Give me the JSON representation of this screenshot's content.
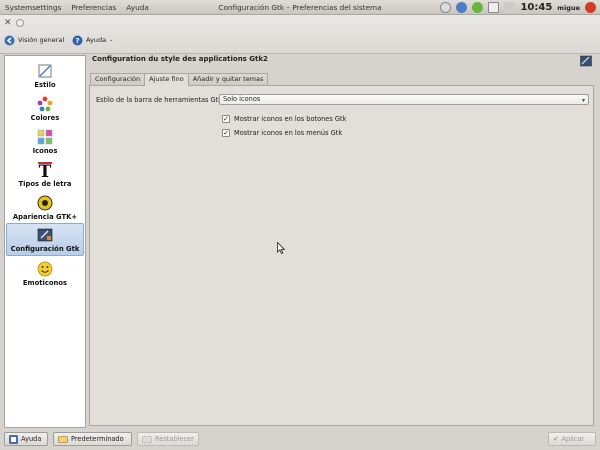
{
  "top_panel": {
    "menus": [
      "Systemsettings",
      "Preferencias",
      "Ayuda"
    ],
    "window_title": "Configuración Gtk – Preferencias del sistema",
    "clock": "10:45",
    "user": "migue"
  },
  "toolbar": {
    "overview_label": "Visión general",
    "help_label": "Ayuda"
  },
  "sidebar": {
    "items": [
      {
        "label": "Estilo",
        "icon": "style-icon"
      },
      {
        "label": "Colores",
        "icon": "colors-icon"
      },
      {
        "label": "Iconos",
        "icon": "icons-icon"
      },
      {
        "label": "Tipos de letra",
        "icon": "fonts-icon"
      },
      {
        "label": "Apariencia GTK+",
        "icon": "gtk-appearance-icon"
      },
      {
        "label": "Configuración Gtk",
        "icon": "gtk-config-icon"
      },
      {
        "label": "Emoticonos",
        "icon": "emoticons-icon"
      }
    ],
    "active_index": 5
  },
  "main": {
    "title": "Configuration du style des applications Gtk2",
    "tabs": [
      "Configuración",
      "Ajuste fino",
      "Añadir y quitar temas"
    ],
    "active_tab": 1,
    "toolbar_style_label": "Estilo de la barra de herramientas Gtk",
    "toolbar_style_value": "Solo iconos",
    "checks": [
      {
        "label": "Mostrar iconos en los botones Gtk",
        "checked": true
      },
      {
        "label": "Mostrar iconos en los menús Gtk",
        "checked": true
      }
    ]
  },
  "bottom": {
    "help_label": "Ayuda",
    "defaults_label": "Predeterminado",
    "reset_label": "Restablecer",
    "apply_label": "Aplicar"
  },
  "colors": {
    "active_item_bg": "#b9cde8",
    "window_bg": "#d6d3cf"
  }
}
